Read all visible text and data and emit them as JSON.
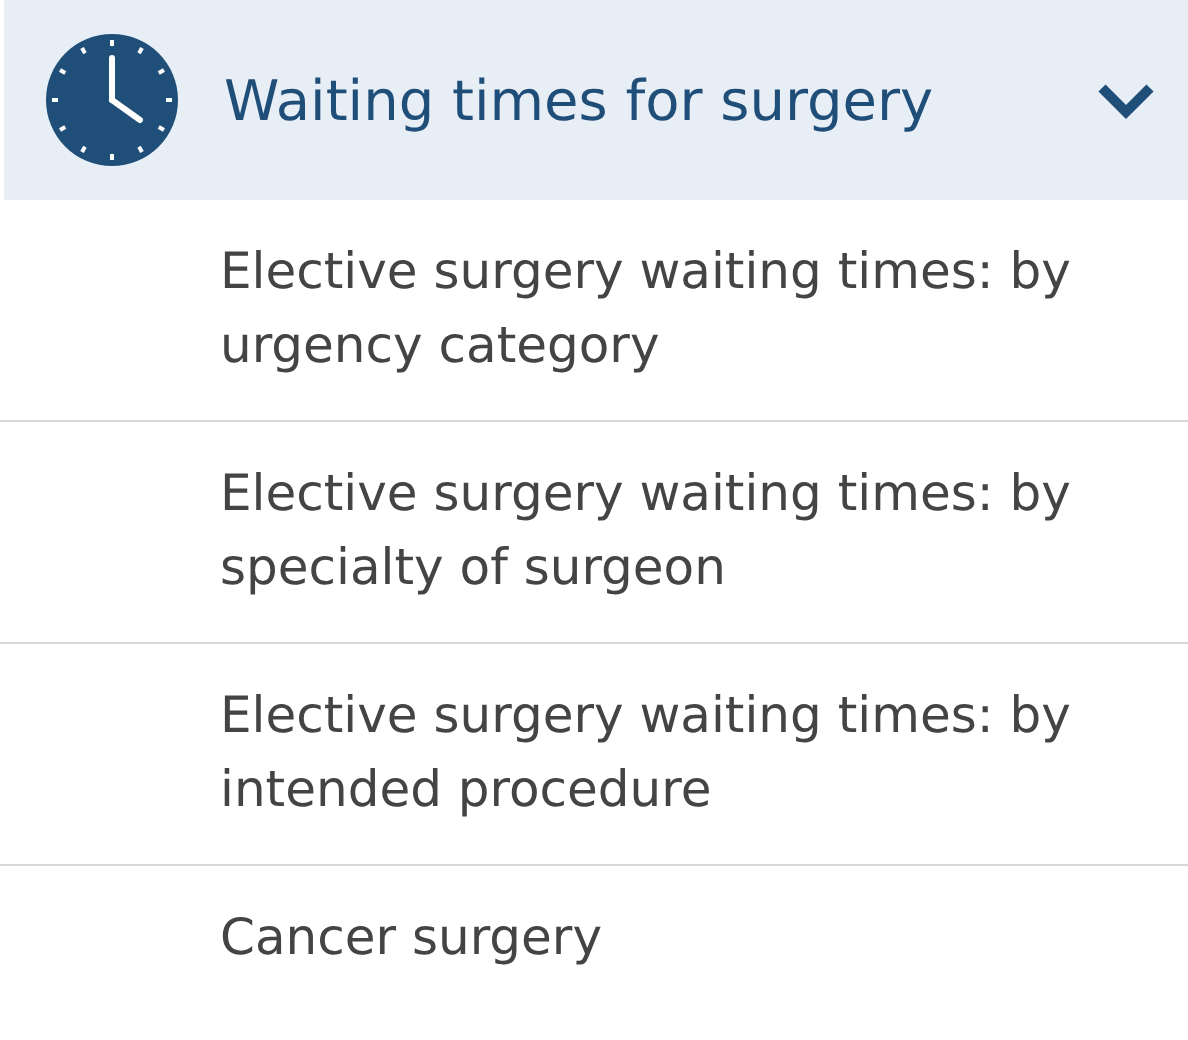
{
  "section": {
    "title": "Waiting times for surgery",
    "expanded": true,
    "items": [
      {
        "label": "Elective surgery waiting times: by urgency category"
      },
      {
        "label": "Elective surgery waiting times: by specialty of surgeon"
      },
      {
        "label": "Elective surgery waiting times: by intended procedure"
      },
      {
        "label": "Cancer surgery"
      }
    ]
  }
}
